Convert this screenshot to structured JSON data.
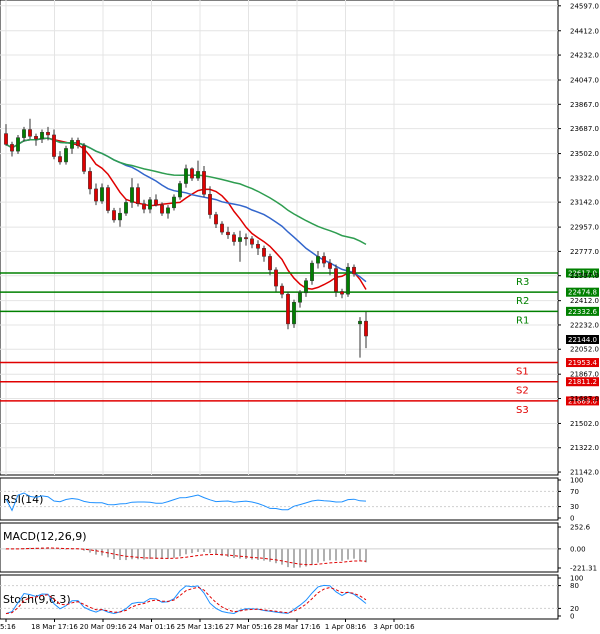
{
  "chart_data": {
    "type": "candlestick",
    "x_ticks": [
      "5:16",
      "18 Mar 17:16",
      "20 Mar 09:16",
      "24 Mar 01:16",
      "25 Mar 13:16",
      "27 Mar 05:16",
      "28 Mar 17:16",
      "1 Apr 08:16",
      "3 Apr 00:16"
    ],
    "price_ticks": [
      "24597.0",
      "24412.0",
      "24232.0",
      "24047.0",
      "23867.0",
      "23687.0",
      "23502.0",
      "23322.0",
      "23142.0",
      "22957.0",
      "22777.0",
      "22597.0",
      "22412.0",
      "22232.0",
      "22052.0",
      "21867.0",
      "21687.0",
      "21502.0",
      "21322.0",
      "21142.0"
    ],
    "ylim": [
      21120,
      24640
    ],
    "current_price": "22144.0",
    "levels": [
      {
        "label": "R3",
        "value": "22617.0",
        "color": "#008000"
      },
      {
        "label": "R2",
        "value": "22474.8",
        "color": "#008000"
      },
      {
        "label": "R1",
        "value": "22332.6",
        "color": "#008000"
      },
      {
        "label": "S1",
        "value": "21953.4",
        "color": "#e00000"
      },
      {
        "label": "S2",
        "value": "21811.2",
        "color": "#e00000"
      },
      {
        "label": "S3",
        "value": "21669.0",
        "color": "#e00000"
      }
    ],
    "candles": [
      [
        23650,
        23720,
        23560,
        23570
      ],
      [
        23570,
        23590,
        23480,
        23520
      ],
      [
        23520,
        23640,
        23500,
        23620
      ],
      [
        23620,
        23700,
        23590,
        23680
      ],
      [
        23680,
        23760,
        23610,
        23630
      ],
      [
        23630,
        23650,
        23560,
        23610
      ],
      [
        23610,
        23680,
        23580,
        23660
      ],
      [
        23660,
        23700,
        23600,
        23640
      ],
      [
        23640,
        23680,
        23460,
        23480
      ],
      [
        23480,
        23520,
        23420,
        23440
      ],
      [
        23440,
        23560,
        23420,
        23540
      ],
      [
        23540,
        23620,
        23500,
        23600
      ],
      [
        23600,
        23620,
        23540,
        23560
      ],
      [
        23560,
        23580,
        23350,
        23370
      ],
      [
        23370,
        23400,
        23200,
        23240
      ],
      [
        23240,
        23280,
        23120,
        23150
      ],
      [
        23150,
        23280,
        23130,
        23250
      ],
      [
        23250,
        23270,
        23060,
        23080
      ],
      [
        23080,
        23100,
        22990,
        23010
      ],
      [
        23010,
        23100,
        22960,
        23060
      ],
      [
        23060,
        23160,
        23040,
        23140
      ],
      [
        23140,
        23320,
        23100,
        23250
      ],
      [
        23250,
        23280,
        23110,
        23130
      ],
      [
        23130,
        23160,
        23060,
        23090
      ],
      [
        23090,
        23180,
        23060,
        23160
      ],
      [
        23160,
        23200,
        23110,
        23120
      ],
      [
        23120,
        23140,
        23040,
        23060
      ],
      [
        23060,
        23120,
        23020,
        23100
      ],
      [
        23100,
        23200,
        23080,
        23180
      ],
      [
        23180,
        23300,
        23160,
        23280
      ],
      [
        23280,
        23420,
        23250,
        23390
      ],
      [
        23390,
        23400,
        23300,
        23320
      ],
      [
        23320,
        23450,
        23300,
        23370
      ],
      [
        23370,
        23410,
        23180,
        23200
      ],
      [
        23200,
        23260,
        23020,
        23050
      ],
      [
        23050,
        23070,
        22950,
        22980
      ],
      [
        22980,
        23000,
        22900,
        22920
      ],
      [
        22920,
        22960,
        22870,
        22900
      ],
      [
        22900,
        22920,
        22820,
        22850
      ],
      [
        22850,
        22930,
        22700,
        22880
      ],
      [
        22880,
        22910,
        22820,
        22870
      ],
      [
        22870,
        22890,
        22800,
        22830
      ],
      [
        22830,
        22860,
        22750,
        22800
      ],
      [
        22800,
        22820,
        22700,
        22740
      ],
      [
        22740,
        22760,
        22600,
        22640
      ],
      [
        22640,
        22660,
        22480,
        22520
      ],
      [
        22520,
        22540,
        22430,
        22460
      ],
      [
        22460,
        22480,
        22200,
        22240
      ],
      [
        22240,
        22420,
        22210,
        22400
      ],
      [
        22400,
        22490,
        22360,
        22470
      ],
      [
        22470,
        22580,
        22440,
        22560
      ],
      [
        22560,
        22710,
        22530,
        22690
      ],
      [
        22690,
        22780,
        22650,
        22740
      ],
      [
        22740,
        22770,
        22660,
        22690
      ],
      [
        22690,
        22720,
        22600,
        22650
      ],
      [
        22650,
        22680,
        22440,
        22480
      ],
      [
        22480,
        22500,
        22430,
        22460
      ],
      [
        22460,
        22690,
        22440,
        22660
      ],
      [
        22660,
        22680,
        22590,
        22610
      ],
      [
        22240,
        22290,
        21990,
        22260
      ],
      [
        22260,
        22330,
        22060,
        22150
      ]
    ]
  },
  "rsi": {
    "label": "RSI(14)",
    "ticks": [
      "100",
      "70",
      "30",
      "0"
    ],
    "color": "#1e90ff"
  },
  "macd": {
    "label": "MACD(12,26,9)",
    "ticks": [
      "252.6",
      "0.00",
      "-221.31"
    ],
    "color": "#b0b0b0",
    "signal_color": "#e00000"
  },
  "stoch": {
    "label": "Stoch(9,6,3)",
    "ticks": [
      "100",
      "80",
      "20",
      "0"
    ],
    "main_color": "#1e90ff",
    "signal_color": "#e00000"
  },
  "colors": {
    "bull": "#008000",
    "bear": "#e00000",
    "ma_fast": "#e00000",
    "ma_mid": "#3366cc",
    "ma_slow": "#2e9d50",
    "grid": "#e4e4e4"
  }
}
